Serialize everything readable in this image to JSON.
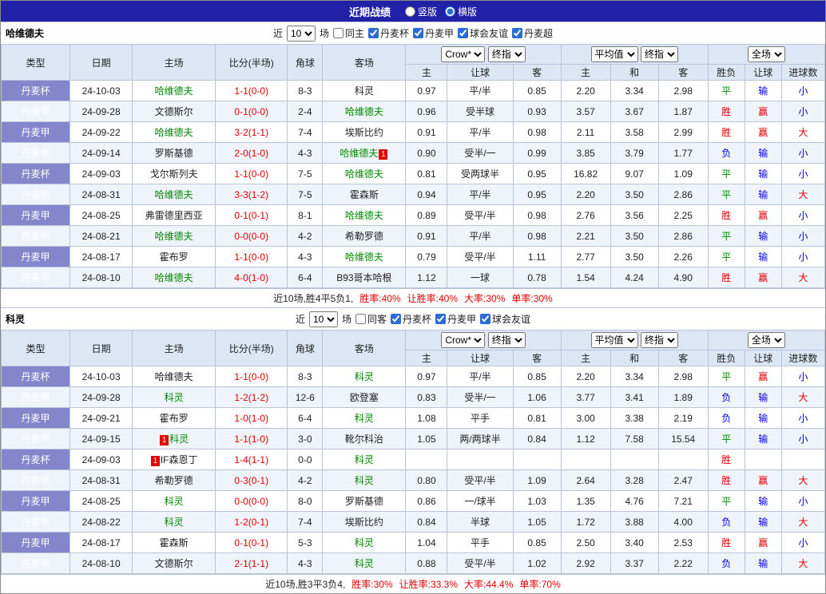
{
  "topbar": {
    "title": "近期战绩",
    "layout_options": [
      {
        "label": "竖版",
        "selected": false
      },
      {
        "label": "横版",
        "selected": true
      }
    ]
  },
  "table_header": {
    "cols": [
      "类型",
      "日期",
      "主场",
      "比分(半场)",
      "角球",
      "客场"
    ],
    "odds_dropdown": "Crow*",
    "final_dropdown": "终指",
    "avg_dropdown": "平均值",
    "final_dropdown2": "终指",
    "fulltime_dropdown": "全场",
    "sub": [
      "主",
      "让球",
      "客",
      "主",
      "和",
      "客",
      "胜负",
      "让球",
      "进球数"
    ]
  },
  "sections": [
    {
      "team": "哈维德夫",
      "filter": {
        "near": "近",
        "count": "10",
        "games": "场",
        "same": {
          "label": "同主",
          "checked": false
        },
        "leagues": [
          {
            "label": "丹麦杯",
            "checked": true
          },
          {
            "label": "丹麦甲",
            "checked": true
          },
          {
            "label": "球会友谊",
            "checked": true
          },
          {
            "label": "丹麦超",
            "checked": true
          }
        ]
      },
      "rows": [
        {
          "type": "丹麦杯",
          "date": "24-10-03",
          "home": "哈维德夫",
          "home_hl": true,
          "score": "1-1(0-0)",
          "corners": "8-3",
          "away": "科灵",
          "away_hl": false,
          "w1": "0.97",
          "hcp": "平/半",
          "w2": "0.85",
          "avg_h": "2.20",
          "avg_d": "3.34",
          "avg_a": "2.98",
          "res": "平",
          "cover": "输",
          "goals": "小"
        },
        {
          "type": "丹麦甲",
          "date": "24-09-28",
          "home": "文德斯尔",
          "home_hl": false,
          "score": "0-1(0-0)",
          "corners": "2-4",
          "away": "哈维德夫",
          "away_hl": true,
          "w1": "0.96",
          "hcp": "受半球",
          "w2": "0.93",
          "avg_h": "3.57",
          "avg_d": "3.67",
          "avg_a": "1.87",
          "res": "胜",
          "cover": "赢",
          "goals": "小"
        },
        {
          "type": "丹麦甲",
          "date": "24-09-22",
          "home": "哈维德夫",
          "home_hl": true,
          "score": "3-2(1-1)",
          "corners": "7-4",
          "away": "埃斯比约",
          "away_hl": false,
          "w1": "0.91",
          "hcp": "平/半",
          "w2": "0.98",
          "avg_h": "2.11",
          "avg_d": "3.58",
          "avg_a": "2.99",
          "res": "胜",
          "cover": "赢",
          "goals": "大"
        },
        {
          "type": "丹麦甲",
          "date": "24-09-14",
          "home": "罗斯基德",
          "home_hl": false,
          "score": "2-0(1-0)",
          "corners": "4-3",
          "away": "哈维德夫",
          "away_hl": true,
          "away_badge": "1",
          "away_badge_pos": "after",
          "w1": "0.90",
          "hcp": "受半/一",
          "w2": "0.99",
          "avg_h": "3.85",
          "avg_d": "3.79",
          "avg_a": "1.77",
          "res": "负",
          "cover": "输",
          "goals": "小"
        },
        {
          "type": "丹麦杯",
          "date": "24-09-03",
          "home": "戈尔斯列夫",
          "home_hl": false,
          "score": "1-1(0-0)",
          "corners": "7-5",
          "away": "哈维德夫",
          "away_hl": true,
          "w1": "0.81",
          "hcp": "受两球半",
          "w2": "0.95",
          "avg_h": "16.82",
          "avg_d": "9.07",
          "avg_a": "1.09",
          "res": "平",
          "cover": "输",
          "goals": "小"
        },
        {
          "type": "丹麦甲",
          "date": "24-08-31",
          "home": "哈维德夫",
          "home_hl": true,
          "score": "3-3(1-2)",
          "corners": "7-5",
          "away": "霍森斯",
          "away_hl": false,
          "w1": "0.94",
          "hcp": "平/半",
          "w2": "0.95",
          "avg_h": "2.20",
          "avg_d": "3.50",
          "avg_a": "2.86",
          "res": "平",
          "cover": "输",
          "goals": "大"
        },
        {
          "type": "丹麦甲",
          "date": "24-08-25",
          "home": "弗雷德里西亚",
          "home_hl": false,
          "score": "0-1(0-1)",
          "corners": "8-1",
          "away": "哈维德夫",
          "away_hl": true,
          "w1": "0.89",
          "hcp": "受平/半",
          "w2": "0.98",
          "avg_h": "2.76",
          "avg_d": "3.56",
          "avg_a": "2.25",
          "res": "胜",
          "cover": "赢",
          "goals": "小"
        },
        {
          "type": "丹麦甲",
          "date": "24-08-21",
          "home": "哈维德夫",
          "home_hl": true,
          "score": "0-0(0-0)",
          "corners": "4-2",
          "away": "希勒罗德",
          "away_hl": false,
          "w1": "0.91",
          "hcp": "平/半",
          "w2": "0.98",
          "avg_h": "2.21",
          "avg_d": "3.50",
          "avg_a": "2.86",
          "res": "平",
          "cover": "输",
          "goals": "小"
        },
        {
          "type": "丹麦甲",
          "date": "24-08-17",
          "home": "霍布罗",
          "home_hl": false,
          "score": "1-1(0-0)",
          "corners": "4-3",
          "away": "哈维德夫",
          "away_hl": true,
          "w1": "0.79",
          "hcp": "受平/半",
          "w2": "1.11",
          "avg_h": "2.77",
          "avg_d": "3.50",
          "avg_a": "2.26",
          "res": "平",
          "cover": "输",
          "goals": "小"
        },
        {
          "type": "丹麦甲",
          "date": "24-08-10",
          "home": "哈维德夫",
          "home_hl": true,
          "score": "4-0(1-0)",
          "corners": "6-4",
          "away": "B93哥本哈根",
          "away_hl": false,
          "w1": "1.12",
          "hcp": "一球",
          "w2": "0.78",
          "avg_h": "1.54",
          "avg_d": "4.24",
          "avg_a": "4.90",
          "res": "胜",
          "cover": "赢",
          "goals": "大"
        }
      ],
      "summary": {
        "prefix": "近10场,胜4平5负1,",
        "stats": [
          "胜率:40%",
          "让胜率:40%",
          "大率:30%",
          "单率:30%"
        ]
      }
    },
    {
      "team": "科灵",
      "filter": {
        "near": "近",
        "count": "10",
        "games": "场",
        "same": {
          "label": "同客",
          "checked": false
        },
        "leagues": [
          {
            "label": "丹麦杯",
            "checked": true
          },
          {
            "label": "丹麦甲",
            "checked": true
          },
          {
            "label": "球会友谊",
            "checked": true
          }
        ]
      },
      "rows": [
        {
          "type": "丹麦杯",
          "date": "24-10-03",
          "home": "哈维德夫",
          "home_hl": false,
          "score": "1-1(0-0)",
          "corners": "8-3",
          "away": "科灵",
          "away_hl": true,
          "w1": "0.97",
          "hcp": "平/半",
          "w2": "0.85",
          "avg_h": "2.20",
          "avg_d": "3.34",
          "avg_a": "2.98",
          "res": "平",
          "cover": "赢",
          "goals": "小"
        },
        {
          "type": "丹麦甲",
          "date": "24-09-28",
          "home": "科灵",
          "home_hl": true,
          "score": "1-2(1-2)",
          "corners": "12-6",
          "away": "欧登塞",
          "away_hl": false,
          "w1": "0.83",
          "hcp": "受半/一",
          "w2": "1.06",
          "avg_h": "3.77",
          "avg_d": "3.41",
          "avg_a": "1.89",
          "res": "负",
          "cover": "输",
          "goals": "大"
        },
        {
          "type": "丹麦甲",
          "date": "24-09-21",
          "home": "霍布罗",
          "home_hl": false,
          "score": "1-0(1-0)",
          "corners": "6-4",
          "away": "科灵",
          "away_hl": true,
          "w1": "1.08",
          "hcp": "平手",
          "w2": "0.81",
          "avg_h": "3.00",
          "avg_d": "3.38",
          "avg_a": "2.19",
          "res": "负",
          "cover": "输",
          "goals": "小"
        },
        {
          "type": "丹麦甲",
          "date": "24-09-15",
          "home": "科灵",
          "home_hl": true,
          "home_badge": "1",
          "home_badge_pos": "before",
          "score": "1-1(1-0)",
          "corners": "3-0",
          "away": "靴尔科治",
          "away_hl": false,
          "w1": "1.05",
          "hcp": "两/两球半",
          "w2": "0.84",
          "avg_h": "1.12",
          "avg_d": "7.58",
          "avg_a": "15.54",
          "res": "平",
          "cover": "输",
          "goals": "小"
        },
        {
          "type": "丹麦杯",
          "date": "24-09-03",
          "home": "IF森恩丁",
          "home_hl": false,
          "home_badge": "1",
          "home_badge_pos": "before",
          "score": "1-4(1-1)",
          "corners": "0-0",
          "away": "科灵",
          "away_hl": true,
          "w1": "",
          "hcp": "",
          "w2": "",
          "avg_h": "",
          "avg_d": "",
          "avg_a": "",
          "res": "胜",
          "cover": "",
          "goals": ""
        },
        {
          "type": "丹麦甲",
          "date": "24-08-31",
          "home": "希勒罗德",
          "home_hl": false,
          "score": "0-3(0-1)",
          "corners": "4-2",
          "away": "科灵",
          "away_hl": true,
          "w1": "0.80",
          "hcp": "受平/半",
          "w2": "1.09",
          "avg_h": "2.64",
          "avg_d": "3.28",
          "avg_a": "2.47",
          "res": "胜",
          "cover": "赢",
          "goals": "大"
        },
        {
          "type": "丹麦甲",
          "date": "24-08-25",
          "home": "科灵",
          "home_hl": true,
          "score": "0-0(0-0)",
          "corners": "8-0",
          "away": "罗斯基德",
          "away_hl": false,
          "w1": "0.86",
          "hcp": "一/球半",
          "w2": "1.03",
          "avg_h": "1.35",
          "avg_d": "4.76",
          "avg_a": "7.21",
          "res": "平",
          "cover": "输",
          "goals": "小"
        },
        {
          "type": "丹麦甲",
          "date": "24-08-22",
          "home": "科灵",
          "home_hl": true,
          "score": "1-2(0-1)",
          "corners": "7-4",
          "away": "埃斯比约",
          "away_hl": false,
          "w1": "0.84",
          "hcp": "半球",
          "w2": "1.05",
          "avg_h": "1.72",
          "avg_d": "3.88",
          "avg_a": "4.00",
          "res": "负",
          "cover": "输",
          "goals": "大"
        },
        {
          "type": "丹麦甲",
          "date": "24-08-17",
          "home": "霍森斯",
          "home_hl": false,
          "score": "0-1(0-1)",
          "corners": "5-3",
          "away": "科灵",
          "away_hl": true,
          "w1": "1.04",
          "hcp": "平手",
          "w2": "0.85",
          "avg_h": "2.50",
          "avg_d": "3.40",
          "avg_a": "2.53",
          "res": "胜",
          "cover": "赢",
          "goals": "小"
        },
        {
          "type": "丹麦甲",
          "date": "24-08-10",
          "home": "文德斯尔",
          "home_hl": false,
          "score": "2-1(1-1)",
          "corners": "4-3",
          "away": "科灵",
          "away_hl": true,
          "w1": "0.88",
          "hcp": "受平/半",
          "w2": "1.02",
          "avg_h": "2.92",
          "avg_d": "3.37",
          "avg_a": "2.22",
          "res": "负",
          "cover": "输",
          "goals": "大"
        }
      ],
      "summary": {
        "prefix": "近10场,胜3平3负4,",
        "stats": [
          "胜率:30%",
          "让胜率:33.3%",
          "大率:44.4%",
          "单率:70%"
        ]
      }
    }
  ]
}
